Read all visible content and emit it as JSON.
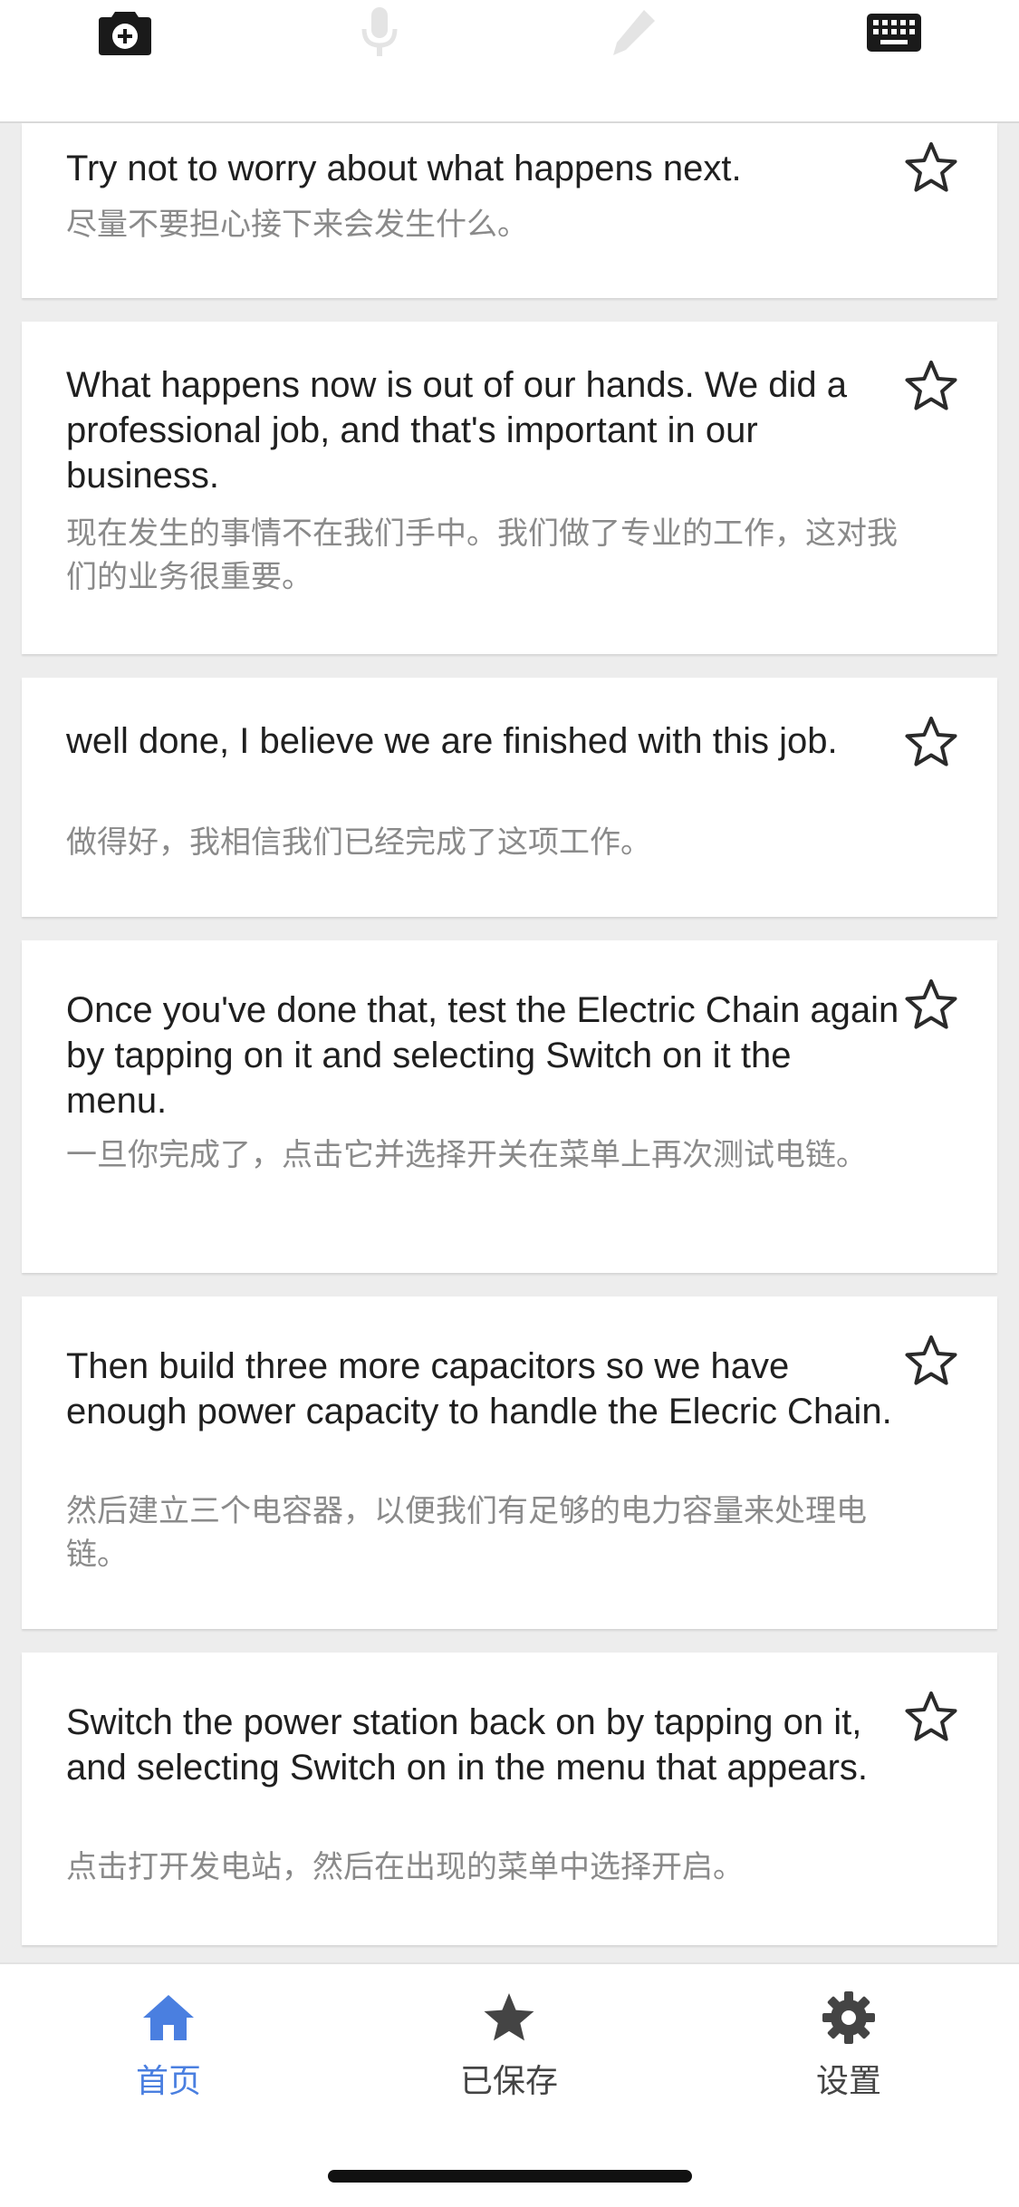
{
  "toolbar": {
    "items": [
      {
        "icon": "camera-icon",
        "enabled": true
      },
      {
        "icon": "microphone-icon",
        "enabled": false
      },
      {
        "icon": "pen-icon",
        "enabled": false
      },
      {
        "icon": "keyboard-icon",
        "enabled": true
      }
    ]
  },
  "phrases": [
    {
      "en": "Try not to worry about what happens next.",
      "zh": "尽量不要担心接下来会发生什么。",
      "starred": false
    },
    {
      "en": "What happens now is out of our hands. We did a professional job, and that's important in our business.",
      "zh": "现在发生的事情不在我们手中。我们做了专业的工作，这对我们的业务很重要。",
      "starred": false
    },
    {
      "en": "well done, I believe we are finished with this job.",
      "zh": "做得好，我相信我们已经完成了这项工作。",
      "starred": false
    },
    {
      "en": "Once you've done that, test the Electric Chain again by tapping on it and selecting Switch on it the menu.",
      "zh": "一旦你完成了，点击它并选择开关在菜单上再次测试电链。",
      "starred": false
    },
    {
      "en": "Then build three more capacitors so we have enough power capacity to handle the Elecric Chain.",
      "zh": "然后建立三个电容器，以便我们有足够的电力容量来处理电链。",
      "starred": false
    },
    {
      "en": "Switch the power station back on by tapping on it, and selecting Switch on in the menu that appears.",
      "zh": "点击打开发电站，然后在出现的菜单中选择开启。",
      "starred": false
    }
  ],
  "tabs": {
    "home": {
      "label": "首页",
      "icon": "home-icon",
      "active": true
    },
    "saved": {
      "label": "已保存",
      "icon": "star-icon",
      "active": false
    },
    "settings": {
      "label": "设置",
      "icon": "gear-icon",
      "active": false
    }
  },
  "colors": {
    "accent": "#4a7fe0",
    "primary_text": "#1f1f1f",
    "secondary_text": "#8a8a8a",
    "background": "#ededed"
  }
}
